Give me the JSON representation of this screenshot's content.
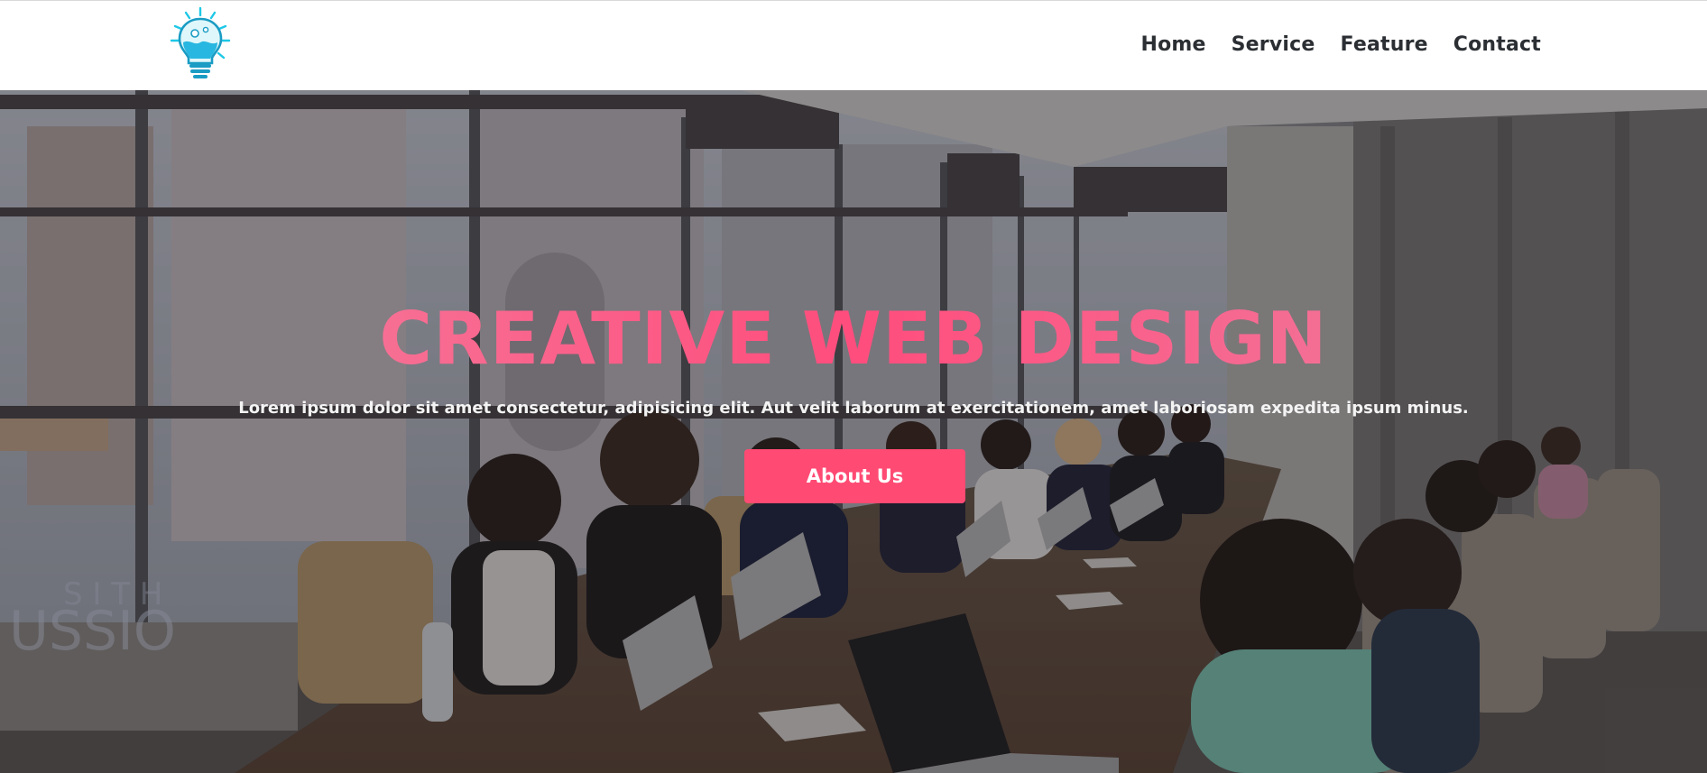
{
  "colors": {
    "accent": "#ff4a73",
    "nav_text": "#2b2f33",
    "header_bg": "#ffffff"
  },
  "header": {
    "logo_icon": "lightbulb-icon",
    "nav": [
      {
        "label": "Home"
      },
      {
        "label": "Service"
      },
      {
        "label": "Feature"
      },
      {
        "label": "Contact"
      }
    ]
  },
  "hero": {
    "background": "conference-room-photo",
    "title": "CREATIVE WEB DESIGN",
    "subtitle": "Lorem ipsum dolor sit amet consectetur, adipisicing elit. Aut velit laborum at exercitationem, amet laboriosam expedita ipsum minus.",
    "button_label": "About Us"
  }
}
